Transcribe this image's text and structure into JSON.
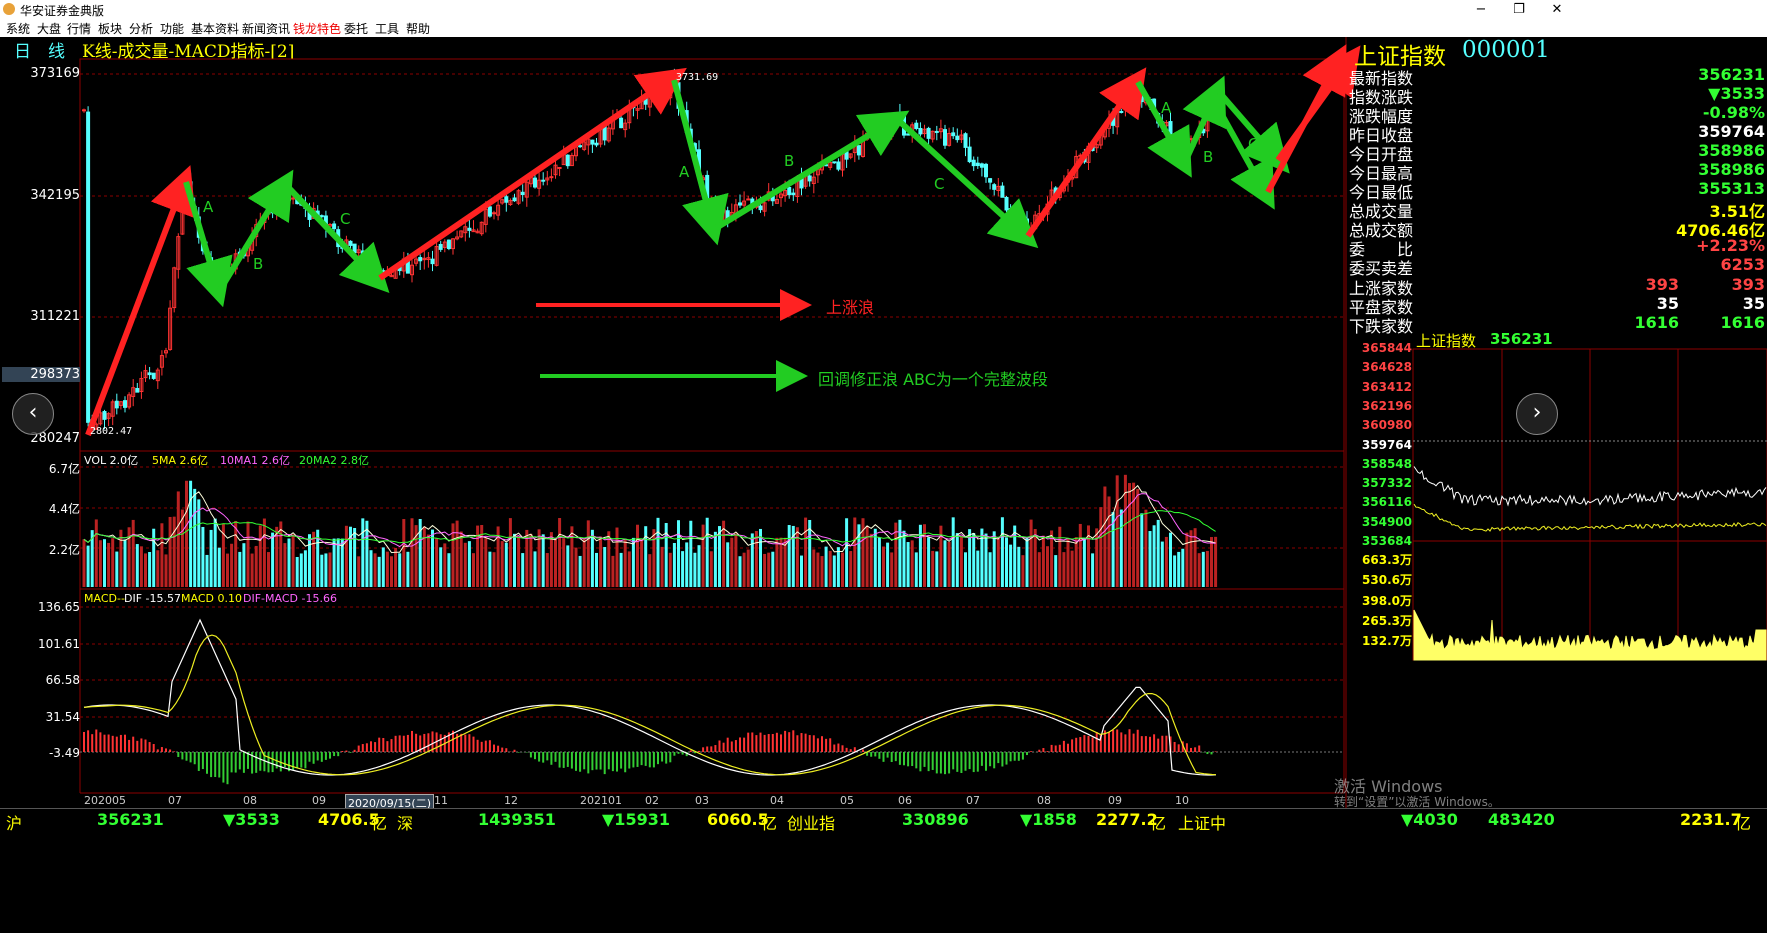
{
  "window": {
    "title": "华安证券金典版",
    "min_label": "−",
    "max_label": "❐",
    "close_label": "✕"
  },
  "menu": [
    "系统",
    "大盘",
    "行情",
    "板块",
    "分析",
    "功能",
    "基本资料",
    "新闻资讯",
    "钱龙特色",
    "委托",
    "工具",
    "帮助"
  ],
  "chart_header": {
    "period": "日　线",
    "indicators": "K线-成交量-MACD指标-[2]"
  },
  "price_axis": [
    {
      "label": "373169"
    },
    {
      "label": "342195"
    },
    {
      "label": "311221"
    },
    {
      "label": "298373"
    },
    {
      "label": "280247"
    }
  ],
  "annotations": {
    "peak": "3731.69",
    "low": "2802.47",
    "legend_up": "上涨浪",
    "legend_correction": "回调修正浪 ABC为一个完整波段",
    "wave_labels": [
      "A",
      "B",
      "C",
      "A",
      "B",
      "C",
      "A",
      "B",
      "C"
    ]
  },
  "vol_header": {
    "vol": "VOL 2.0亿",
    "ma5": "5MA 2.6亿",
    "ma10": "10MA1 2.6亿",
    "ma20": "20MA2 2.8亿"
  },
  "vol_axis": [
    "6.7亿",
    "4.4亿",
    "2.2亿"
  ],
  "macd_header": {
    "name": "MACD--",
    "dif": "DIF -15.57",
    "macd": "MACD 0.10",
    "diff": "DIF-MACD -15.66"
  },
  "macd_axis": [
    "136.65",
    "101.61",
    "66.58",
    "31.54",
    "-3.49"
  ],
  "date_axis": [
    "202005",
    "07",
    "08",
    "09",
    "2020/09/15(二)",
    "11",
    "12",
    "202101",
    "02",
    "03",
    "04",
    "05",
    "06",
    "07",
    "08",
    "09",
    "10"
  ],
  "index_panel": {
    "name": "上证指数",
    "code": "000001",
    "rows": [
      {
        "label": "最新指数",
        "value": "356231",
        "color": "#3f3"
      },
      {
        "label": "指数涨跌",
        "value": "▼3533",
        "color": "#3f3"
      },
      {
        "label": "涨跌幅度",
        "value": "-0.98%",
        "color": "#3f3"
      },
      {
        "label": "昨日收盘",
        "value": "359764",
        "color": "#fff"
      },
      {
        "label": "今日开盘",
        "value": "358986",
        "color": "#3f3"
      },
      {
        "label": "今日最高",
        "value": "358986",
        "color": "#3f3"
      },
      {
        "label": "今日最低",
        "value": "355313",
        "color": "#3f3"
      },
      {
        "label": "总成交量",
        "value": "3.51亿",
        "color": "#ff0"
      },
      {
        "label": "总成交额",
        "value": "4706.46亿",
        "color": "#ff0"
      }
    ],
    "rows2": [
      {
        "label": "委　　比",
        "value": "+2.23%",
        "color": "#f44"
      },
      {
        "label": "委买卖差",
        "value": "6253",
        "color": "#f44"
      }
    ],
    "breadth": [
      {
        "label": "上涨家数",
        "v1": "393",
        "v2": "393",
        "color": "#f44"
      },
      {
        "label": "平盘家数",
        "v1": "35",
        "v2": "35",
        "color": "#fff"
      },
      {
        "label": "下跌家数",
        "v1": "1616",
        "v2": "1616",
        "color": "#3f3"
      }
    ]
  },
  "intraday": {
    "title": "上证指数",
    "value": "356231",
    "price_axis": [
      {
        "label": "365844",
        "color": "#f44"
      },
      {
        "label": "364628",
        "color": "#f44"
      },
      {
        "label": "363412",
        "color": "#f44"
      },
      {
        "label": "362196",
        "color": "#f44"
      },
      {
        "label": "360980",
        "color": "#f44"
      },
      {
        "label": "359764",
        "color": "#fff"
      },
      {
        "label": "358548",
        "color": "#3f3"
      },
      {
        "label": "357332",
        "color": "#3f3"
      },
      {
        "label": "356116",
        "color": "#3f3"
      },
      {
        "label": "354900",
        "color": "#3f3"
      },
      {
        "label": "353684",
        "color": "#3f3"
      }
    ],
    "vol_axis": [
      "663.3万",
      "530.6万",
      "398.0万",
      "265.3万",
      "132.7万"
    ]
  },
  "ticker": {
    "sh_label": "沪",
    "sh_index": "356231",
    "sh_change": "▼3533",
    "sh_amount": "4706.5",
    "sz_label": "深",
    "sz_index": "1439351",
    "sz_change": "▼15931",
    "sz_amount": "6060.5",
    "cy_label": "创业指",
    "cy_index": "330896",
    "cy_change": "▼1858",
    "cy_amount": "2277.2",
    "unit": "亿",
    "status": "上证中",
    "status_index": "483420",
    "status_change": "▼4030",
    "status_amount": "2231.7"
  },
  "system_watermark": {
    "line1": "激活 Windows",
    "line2": "转到“设置”以激活 Windows。"
  },
  "colors": {
    "up": "#f44",
    "down": "#3f3",
    "grid": "#8b0000",
    "vol_up": "#b22",
    "vol_down": "#5ff",
    "title_gold": "#ff0",
    "code_cyan": "#5ff"
  }
}
